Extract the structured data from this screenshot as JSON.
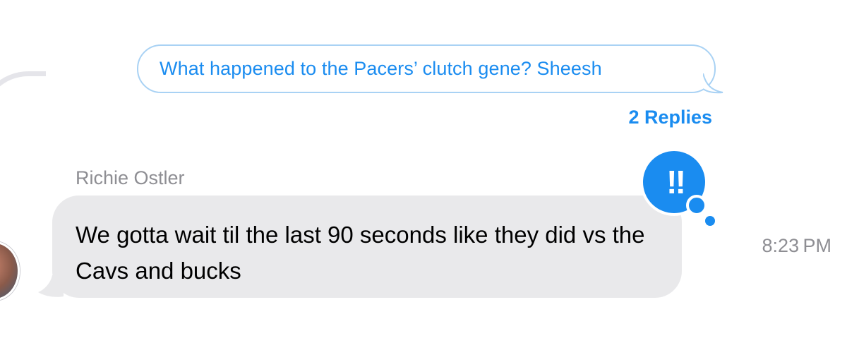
{
  "thread": {
    "quoted_message": "What happened to the Pacers’ clutch gene? Sheesh",
    "replies_label": "2 Replies"
  },
  "message": {
    "sender": "Richie  Ostler",
    "text": "We gotta wait til the last 90 seconds like they did vs the Cavs and bucks",
    "time": "8:23 PM",
    "tapback": "‼"
  },
  "colors": {
    "accent": "#1a8cf0",
    "quoted_border": "#a9d2f4",
    "received_bubble": "#e9e9eb",
    "secondary_text": "#8e8e93"
  },
  "icons": {
    "tapback": "double-exclamation-icon"
  }
}
